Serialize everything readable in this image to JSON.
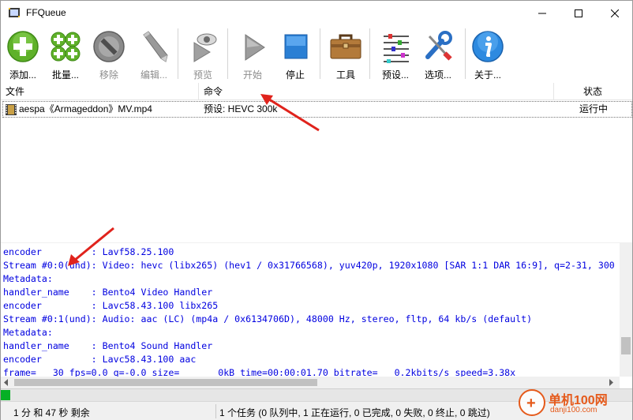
{
  "window": {
    "title": "FFQueue"
  },
  "toolbar": {
    "buttons": [
      {
        "label": "添加...",
        "icon": "plus-circle-green",
        "enabled": true
      },
      {
        "label": "批量...",
        "icon": "batch-plus-green",
        "enabled": true
      },
      {
        "label": "移除",
        "icon": "remove-circle-gray",
        "enabled": false
      },
      {
        "label": "编辑...",
        "icon": "pencil",
        "enabled": false
      },
      {
        "label": "预览",
        "icon": "eye-play",
        "enabled": false
      },
      {
        "label": "开始",
        "icon": "play-triangle",
        "enabled": false
      },
      {
        "label": "停止",
        "icon": "stop-square-blue",
        "enabled": true
      },
      {
        "label": "工具",
        "icon": "toolbox",
        "enabled": true
      },
      {
        "label": "预设...",
        "icon": "sliders",
        "enabled": true
      },
      {
        "label": "选项...",
        "icon": "wrench-screwdriver",
        "enabled": true
      },
      {
        "label": "关于...",
        "icon": "info-circle-blue",
        "enabled": true
      }
    ]
  },
  "joblist": {
    "columns": [
      "文件",
      "命令",
      "状态"
    ],
    "rows": [
      {
        "file": "aespa《Armageddon》MV.mp4",
        "command": "预设: HEVC 300k",
        "status": "运行中"
      }
    ]
  },
  "log": {
    "lines": [
      "encoder         : Lavf58.25.100",
      "Stream #0:0(und): Video: hevc (libx265) (hev1 / 0x31766568), yuv420p, 1920x1080 [SAR 1:1 DAR 16:9], q=2-31, 300",
      "Metadata:",
      "handler_name    : Bento4 Video Handler",
      "encoder         : Lavc58.43.100 libx265",
      "Stream #0:1(und): Audio: aac (LC) (mp4a / 0x6134706D), 48000 Hz, stereo, fltp, 64 kb/s (default)",
      "Metadata:",
      "handler_name    : Bento4 Sound Handler",
      "encoder         : Lavc58.43.100 aac",
      "frame=   30 fps=0.0 q=-0.0 size=       0kB time=00:00:01.70 bitrate=   0.2kbits/s speed=3.38x"
    ]
  },
  "progress": {
    "fraction": 0.015,
    "color": "#06b025"
  },
  "status": {
    "remaining": "1 分 和 47 秒 剩余",
    "summary": "1 个任务 (0 队列中, 1 正在运行, 0 已完成, 0 失败, 0 终止, 0 跳过)"
  },
  "watermark": {
    "site": "单机100网",
    "url": "danji100.com"
  },
  "colors": {
    "log_text": "#0000e0",
    "annotation_arrow": "#e0231c",
    "progress": "#06b025"
  }
}
